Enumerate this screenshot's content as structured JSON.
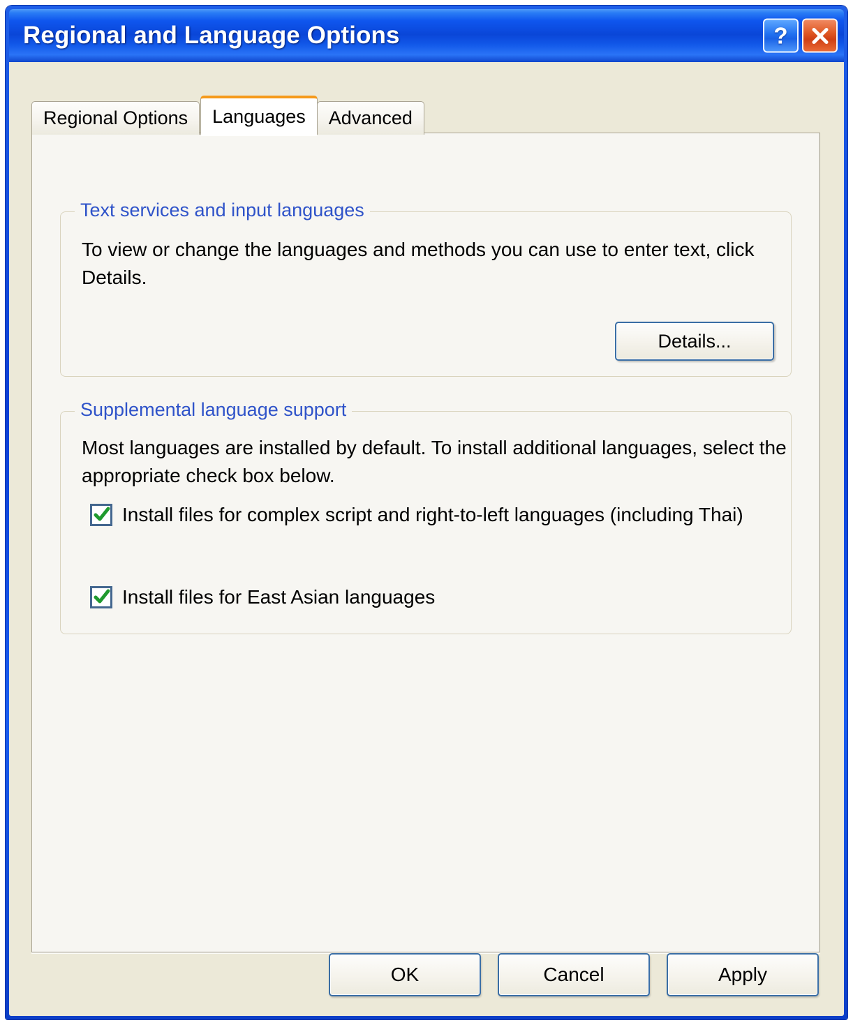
{
  "window": {
    "title": "Regional and Language Options",
    "help_button": "?",
    "close_button": "X"
  },
  "tabs": [
    {
      "label": "Regional Options",
      "active": false
    },
    {
      "label": "Languages",
      "active": true
    },
    {
      "label": "Advanced",
      "active": false
    }
  ],
  "groups": {
    "text_services": {
      "legend": "Text services and input languages",
      "description": "To view or change the languages and methods you can use to enter text, click Details.",
      "details_button": "Details..."
    },
    "supplemental": {
      "legend": "Supplemental language support",
      "description": "Most languages are installed by default. To install additional languages, select the appropriate check box below.",
      "checkboxes": [
        {
          "label": "Install files for complex script and right-to-left languages (including Thai)",
          "checked": true
        },
        {
          "label": "Install files for East Asian languages",
          "checked": true
        }
      ]
    }
  },
  "buttons": {
    "ok": "OK",
    "cancel": "Cancel",
    "apply": "Apply"
  },
  "colors": {
    "titlebar_blue": "#0a46d8",
    "dialog_background": "#ece9d8",
    "panel_background": "#f7f6f2",
    "legend_blue": "#2f53c9",
    "active_tab_orange": "#f59a1c",
    "close_button_red": "#cf3f14",
    "checkmark_green": "#1f9a2e",
    "button_border": "#3a6ea5"
  }
}
